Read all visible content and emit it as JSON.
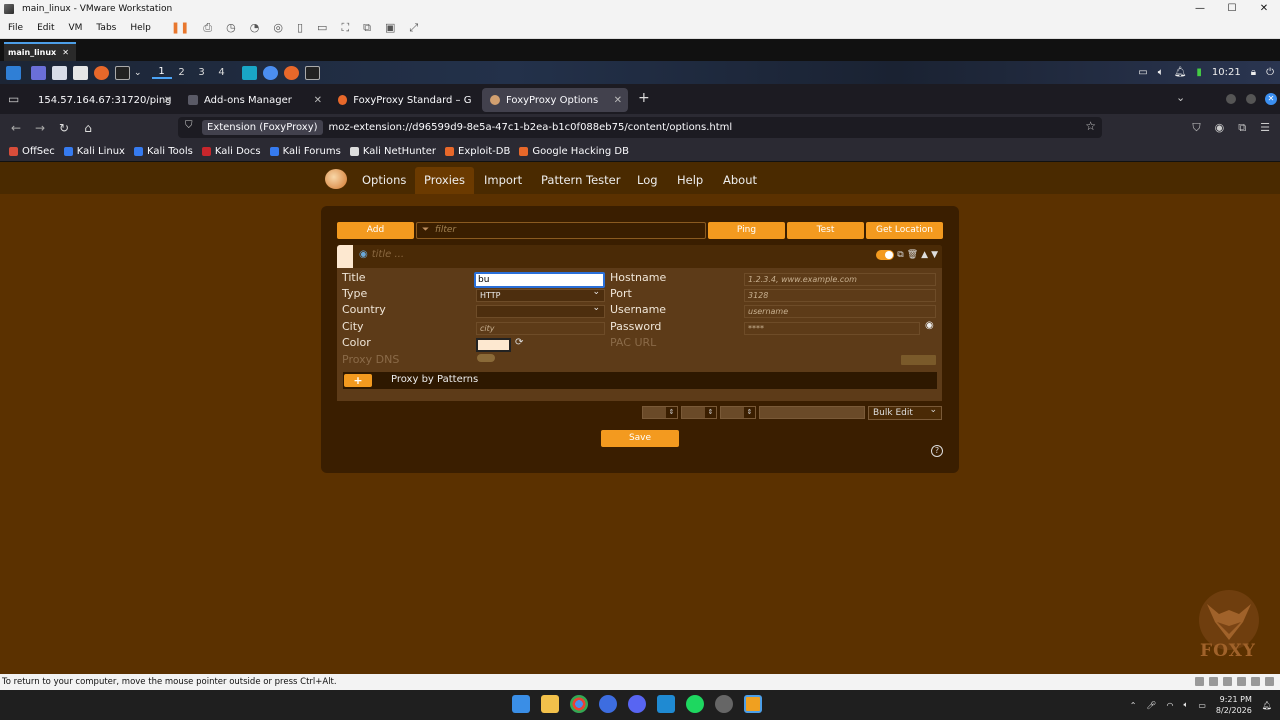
{
  "vmware": {
    "window_title": "main_linux - VMware Workstation",
    "menu": [
      "File",
      "Edit",
      "VM",
      "Tabs",
      "Help"
    ],
    "tab": "main_linux",
    "status_text": "To return to your computer, move the mouse pointer outside or press Ctrl+Alt."
  },
  "kali_panel": {
    "workspaces": [
      "1",
      "2",
      "3",
      "4"
    ],
    "time": "10:21"
  },
  "firefox": {
    "tabs": [
      {
        "label": "154.57.164.67:31720/ping"
      },
      {
        "label": "Add-ons Manager"
      },
      {
        "label": "FoxyProxy Standard – Get"
      },
      {
        "label": "FoxyProxy Options"
      }
    ],
    "extension_chip": "Extension (FoxyProxy)",
    "url": "moz-extension://d96599d9-8e5a-47c1-b2ea-b1c0f088eb75/content/options.html",
    "bookmarks": [
      "OffSec",
      "Kali Linux",
      "Kali Tools",
      "Kali Docs",
      "Kali Forums",
      "Kali NetHunter",
      "Exploit-DB",
      "Google Hacking DB"
    ]
  },
  "foxyproxy": {
    "nav": [
      "Options",
      "Proxies",
      "Import",
      "Pattern Tester",
      "Log",
      "Help",
      "About"
    ],
    "toolbar": {
      "add": "Add",
      "filter_placeholder": "filter",
      "ping": "Ping",
      "test": "Test",
      "get_location": "Get Location"
    },
    "proxy": {
      "header_title_placeholder": "title ...",
      "labels": {
        "title": "Title",
        "type": "Type",
        "country": "Country",
        "city": "City",
        "color": "Color",
        "proxy_dns": "Proxy DNS",
        "hostname": "Hostname",
        "port": "Port",
        "username": "Username",
        "password": "Password",
        "pac_url": "PAC URL"
      },
      "title_value": "bu",
      "type_value": "HTTP",
      "country_value": "",
      "city_placeholder": "city",
      "hostname_placeholder": "1.2.3.4, www.example.com",
      "port_placeholder": "3128",
      "username_placeholder": "username",
      "password_placeholder": "****",
      "color": "#fde8d0",
      "patterns_label": "Proxy by Patterns"
    },
    "bulk_edit": "Bulk Edit",
    "save": "Save",
    "watermark": "FOXY"
  },
  "taskbar": {
    "time": "9:21 PM",
    "date": "8/2/2026"
  },
  "colors": {
    "accent": "#f39a1f",
    "page_bg": "#5b3100",
    "panel_bg": "#3a1e00"
  }
}
